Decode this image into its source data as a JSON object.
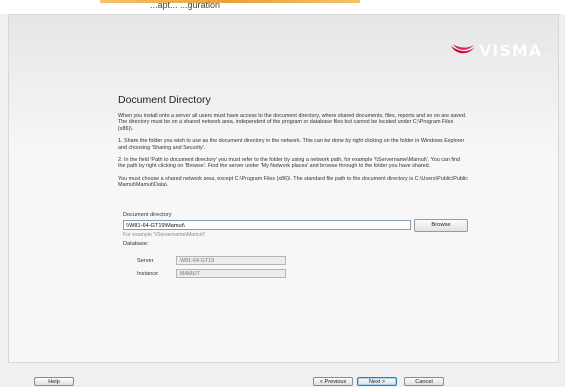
{
  "header": {
    "title": "...apt... ...guration"
  },
  "brand": {
    "name": "VISMA",
    "registered": "®",
    "accent_color": "#d4003a"
  },
  "document_directory": {
    "heading": "Document Directory",
    "intro": "When you install onto a server all users must have access to the document directory, where shared documents, files, reports and so on are saved. The directory must be on a shared network area, independent of the program or database files but cannot be located under C:\\Program Files (x86)\\.",
    "step1": "1.   Share the folder you wish to use as the document directory in the network. This can be done by right clicking on the folder in Windows Explorer and choosing 'Sharing and Security'.",
    "step2": "2.   In the field 'Path to document directory' you must refer to the folder by using a network path, for example '\\\\Servername\\Mamut\\'. You can find the path by right clicking on 'Browse'. Find the server under 'My Network places' and browse through to the folder you have shared.",
    "note": "You must choose a shared network area, except C:\\Program Files (x86)\\. The standard file path to the document directory is C:\\Users\\Public\\Public Mamut\\Mamut\\Data\\.",
    "field_label": "Document directory",
    "path_value": "\\\\W81-64-GT19\\Mamut\\",
    "browse_label": "Browse",
    "example_hint": "For example '\\\\Servername\\Mamut\\'"
  },
  "database": {
    "label": "Database:",
    "server_label": "Server",
    "server_value": "W81-64-GT19",
    "instance_label": "Instance",
    "instance_value": "MAMUT"
  },
  "footer": {
    "help_label": "Help",
    "previous_label": "< Previous",
    "next_label": "Next >",
    "cancel_label": "Cancel"
  }
}
